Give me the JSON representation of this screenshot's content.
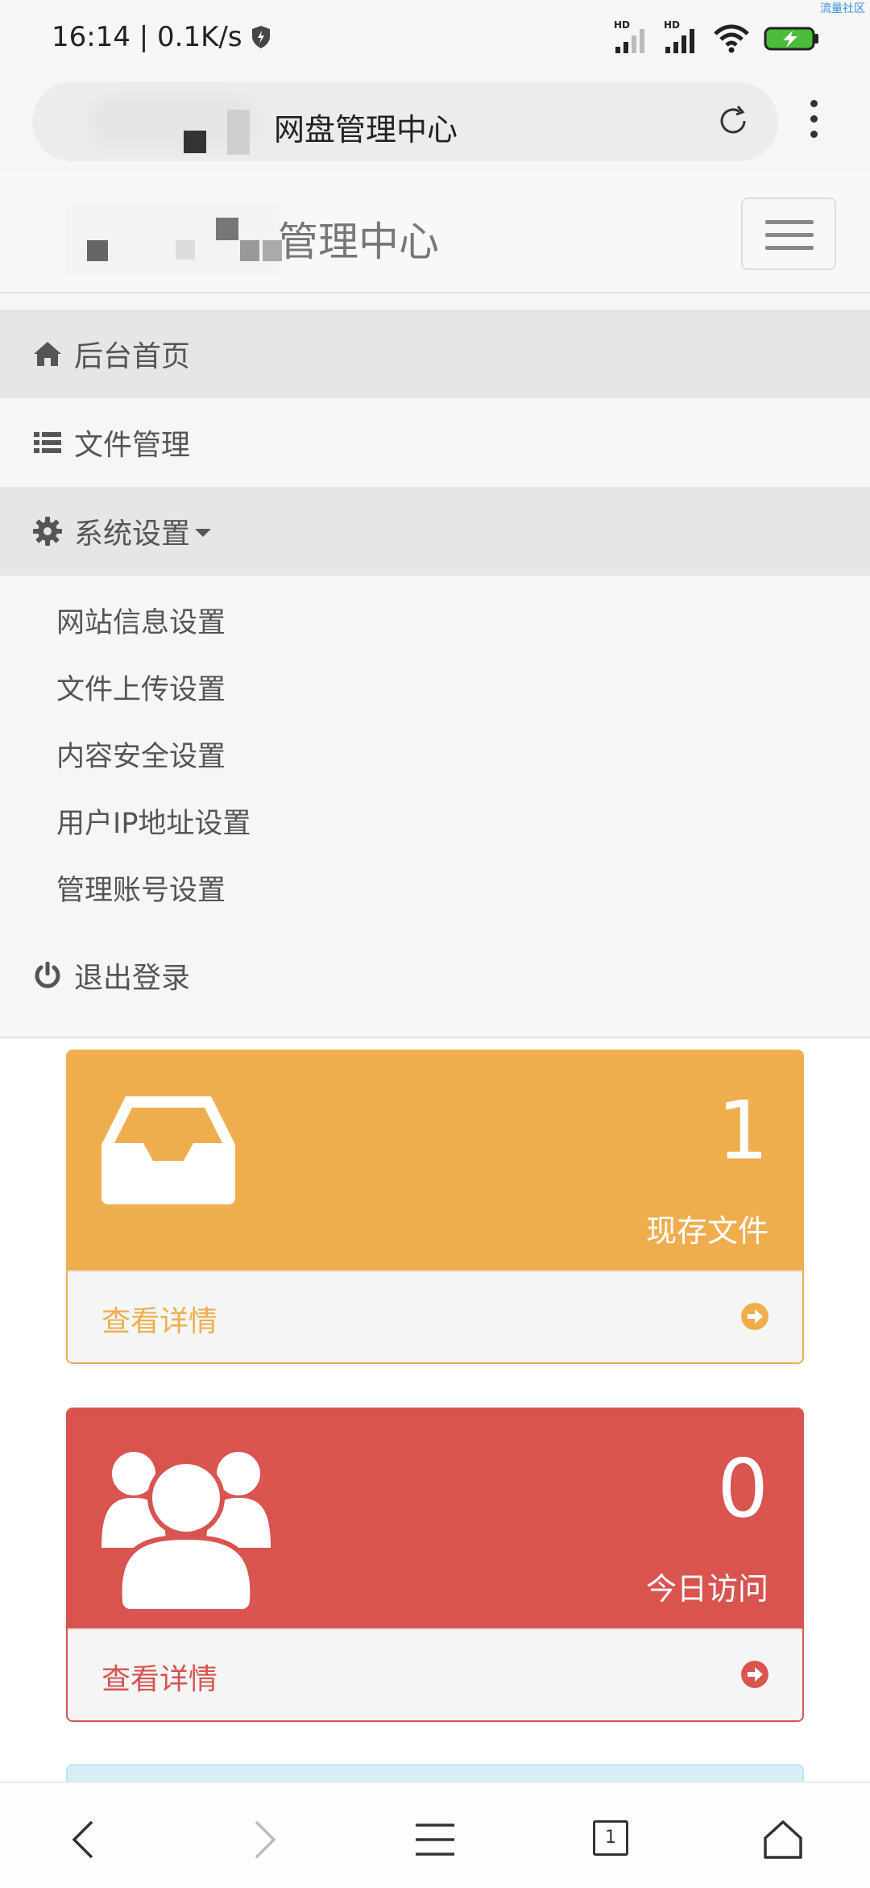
{
  "status": {
    "time_net": "16:14 | 0.1K/s",
    "hd1": "HD",
    "hd2": "HD",
    "watermark": "流量社区"
  },
  "browser": {
    "url_title": "网盘管理中心"
  },
  "navbar": {
    "brand": "管理中心"
  },
  "menu": {
    "home": "后台首页",
    "files": "文件管理",
    "settings": "系统设置",
    "sub": [
      "网站信息设置",
      "文件上传设置",
      "内容安全设置",
      "用户IP地址设置",
      "管理账号设置"
    ],
    "logout": "退出登录"
  },
  "cards": [
    {
      "value": "1",
      "label": "现存文件",
      "detail": "查看详情",
      "color": "#f0ad4e"
    },
    {
      "value": "0",
      "label": "今日访问",
      "detail": "查看详情",
      "color": "#d9534f"
    }
  ],
  "tabs_count": "1"
}
